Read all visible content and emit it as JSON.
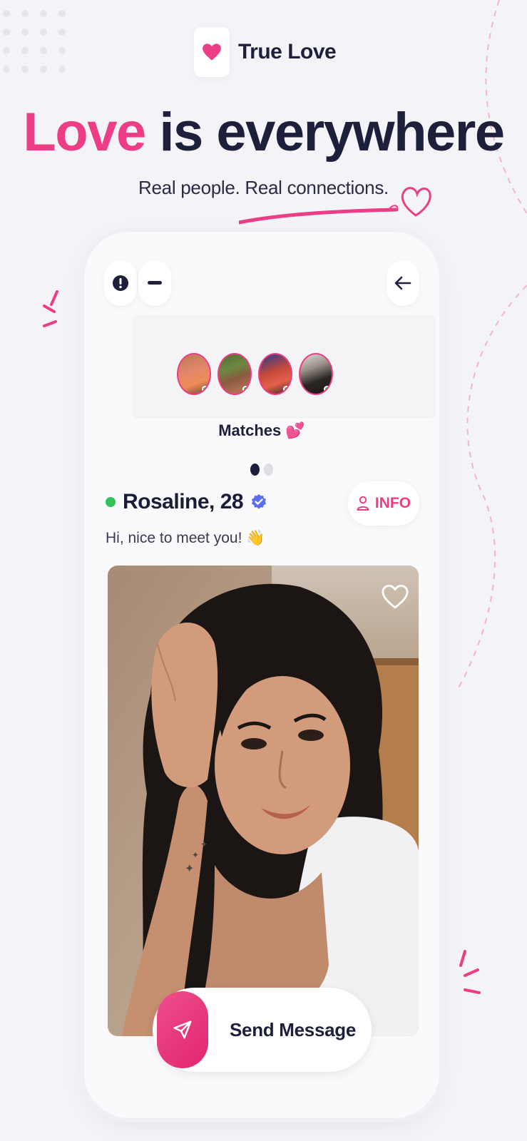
{
  "brand": {
    "name": "True Love",
    "logo_icon": "heart-icon"
  },
  "headline": {
    "accent": "Love",
    "rest": " is everywhere"
  },
  "subline": "Real people. Real connections.",
  "toolbar": {
    "report_icon": "exclamation-icon",
    "minus_icon": "minus-icon",
    "back_icon": "arrow-left-icon"
  },
  "matches": {
    "label": "Matches 💕",
    "avatar_count": 4,
    "page_count": 2,
    "active_page": 1
  },
  "profile": {
    "name": "Rosaline, 28",
    "status": "online",
    "verified": true,
    "greeting": "Hi, nice to meet you! 👋",
    "info_label": "INFO"
  },
  "actions": {
    "favorite_icon": "heart-outline-icon",
    "send_label": "Send Message",
    "send_icon": "paper-plane-icon"
  },
  "colors": {
    "accent": "#ec3d86",
    "dark": "#1d1f3b",
    "online": "#34c25a",
    "verified": "#5a6cf0",
    "background": "#f4f3f7"
  }
}
